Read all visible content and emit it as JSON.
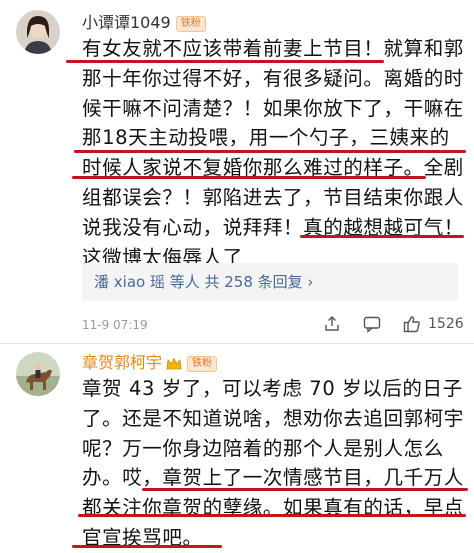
{
  "comments": [
    {
      "username": "小谭谭1049",
      "badge": "铁粉",
      "avatar_icon": "user-avatar-girl",
      "lines": [
        "有女友就不应该带着前妻上节目！就算和郭",
        "那十年你过得不好，有很多疑问。离婚的时",
        "候干嘛不问清楚？！如果你放下了，干嘛在",
        "那18天主动投喂，用一个勺子，三姨来的",
        "时候人家说不复婚你那么难过的样子。全剧",
        "组都误会？！郭陷进去了，节目结束你跟人",
        "说我没有心动，说拜拜！真的越想越可气！",
        "这微博太侮辱人了"
      ],
      "replies_text": "潘 xiao 瑶 等人  共 258 条回复 ›",
      "timestamp": "11-9 07:19",
      "share_icon": "share-icon",
      "comment_icon": "comment-icon",
      "like_icon": "thumbs-up-icon",
      "like_count": "1526"
    },
    {
      "username": "章贺郭柯宇",
      "badge": "铁粉",
      "crown_icon": "crown-icon",
      "avatar_icon": "user-avatar-horse",
      "lines": [
        "章贺 43 岁了，可以考虑 70 岁以后的日子",
        "了。还是不知道说啥，想劝你去追回郭柯宇",
        "呢？万一你身边陪着的那个人是别人怎么",
        "办。哎，章贺上了一次情感节目，几千万人",
        "都关注你章贺的孽缘。如果真有的话，早点",
        "官宣挨骂吧。"
      ]
    }
  ],
  "colors": {
    "username": "#333333",
    "username2": "#e08a1c",
    "underline": "#c4141d",
    "link": "#4a6a96",
    "meta": "#9a9a9a"
  }
}
